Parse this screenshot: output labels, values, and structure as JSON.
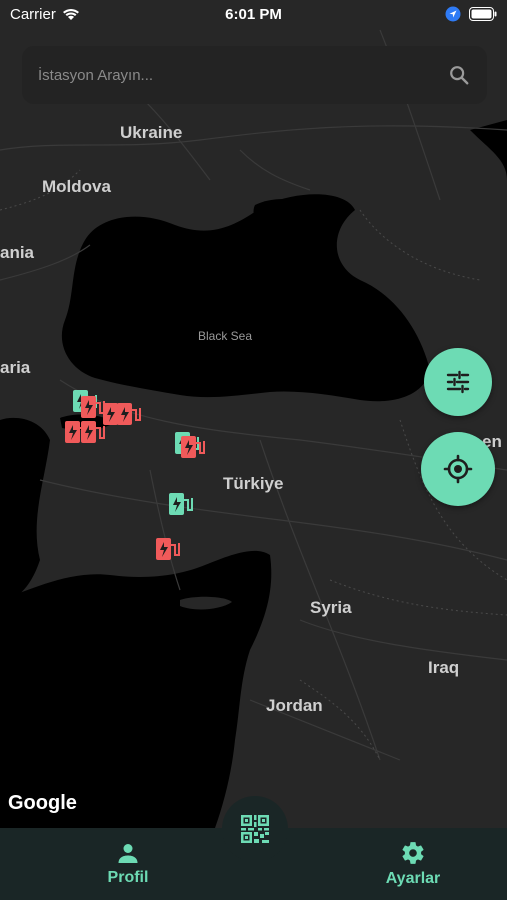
{
  "status_bar": {
    "carrier": "Carrier",
    "time": "6:01 PM"
  },
  "search": {
    "placeholder": "İstasyon Arayın..."
  },
  "map": {
    "labels": {
      "ukraine": "Ukraine",
      "moldova": "Moldova",
      "romania_partial": "ania",
      "bulgaria_partial": "aria",
      "black_sea": "Black Sea",
      "turkiye": "Türkiye",
      "syria": "Syria",
      "iraq": "Iraq",
      "jordan": "Jordan",
      "georgia_partial": "en"
    },
    "attribution": "Google",
    "marker_colors": {
      "available": "#6ddbb4",
      "busy": "#f05a5a"
    }
  },
  "buttons": {
    "filter_icon": "sliders-icon",
    "locate_icon": "crosshair-icon",
    "qr_icon": "qr-code-icon"
  },
  "nav": {
    "profil": "Profil",
    "ayarlar": "Ayarlar"
  },
  "colors": {
    "accent": "#6ddbb4",
    "nav_bg": "#1a2626",
    "map_bg": "#272727",
    "water": "#000000"
  }
}
